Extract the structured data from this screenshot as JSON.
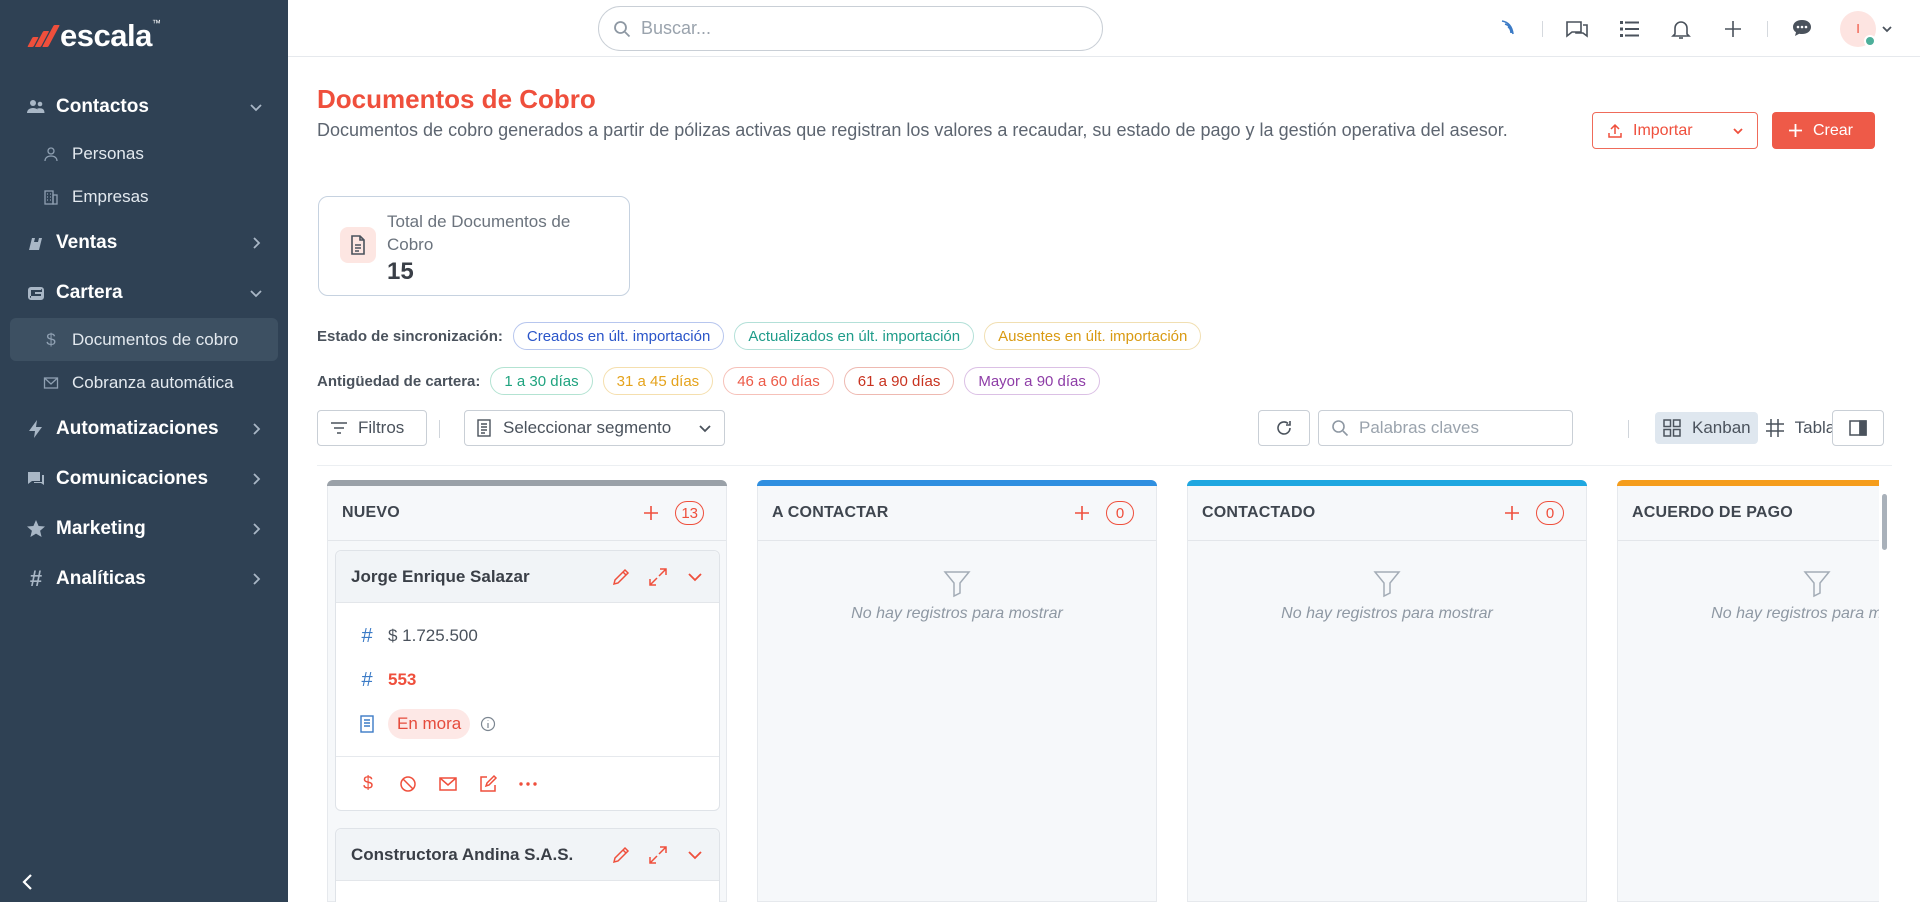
{
  "app": {
    "brand": "escala",
    "brand_tm": "™"
  },
  "sidebar": {
    "groups": [
      {
        "label": "Contactos",
        "icon": "contacts-icon",
        "expanded": true
      },
      {
        "label": "Ventas",
        "icon": "sales-icon",
        "expanded": false
      },
      {
        "label": "Cartera",
        "icon": "wallet-icon",
        "expanded": true
      },
      {
        "label": "Automatizaciones",
        "icon": "bolt-icon",
        "expanded": false
      },
      {
        "label": "Comunicaciones",
        "icon": "chat-icon",
        "expanded": false
      },
      {
        "label": "Marketing",
        "icon": "star-icon",
        "expanded": false
      },
      {
        "label": "Analíticas",
        "icon": "hash-icon",
        "expanded": false
      }
    ],
    "contactos_items": [
      {
        "label": "Personas"
      },
      {
        "label": "Empresas"
      }
    ],
    "cartera_items": [
      {
        "label": "Documentos de cobro",
        "active": true
      },
      {
        "label": "Cobranza automática"
      }
    ]
  },
  "topbar": {
    "search_placeholder": "Buscar...",
    "avatar_initial": "I"
  },
  "page": {
    "title": "Documentos de Cobro",
    "description": "Documentos de cobro generados a partir de pólizas activas que registran los valores a recaudar, su estado de pago y la gestión operativa del asesor.",
    "import_label": "Importar",
    "create_label": "Crear"
  },
  "stat": {
    "label": "Total de Documentos de Cobro",
    "value": "15"
  },
  "sync": {
    "label": "Estado de sincronización:",
    "chips": [
      {
        "label": "Creados en últ. importación",
        "color": "#2a55c9"
      },
      {
        "label": "Actualizados en últ. importación",
        "color": "#1f9c8a"
      },
      {
        "label": "Ausentes en últ. importación",
        "color": "#d99a12"
      }
    ]
  },
  "aging": {
    "label": "Antigüedad de cartera:",
    "chips": [
      {
        "label": "1 a 30 días",
        "color": "#1fa37f"
      },
      {
        "label": "31 a 45 días",
        "color": "#e5a31c"
      },
      {
        "label": "46 a 60 días",
        "color": "#ec5a47"
      },
      {
        "label": "61 a 90 días",
        "color": "#c8321f"
      },
      {
        "label": "Mayor a 90 días",
        "color": "#8e3da7"
      }
    ]
  },
  "toolbar": {
    "filters_label": "Filtros",
    "segment_label": "Seleccionar segmento",
    "keywords_placeholder": "Palabras claves",
    "kanban_label": "Kanban",
    "table_label": "Tabla"
  },
  "board": {
    "columns": [
      {
        "title": "NUEVO",
        "count": "13",
        "color": "#9aa1a8"
      },
      {
        "title": "A CONTACTAR",
        "count": "0",
        "color": "#2f8fe0"
      },
      {
        "title": "CONTACTADO",
        "count": "0",
        "color": "#1fa7e0"
      },
      {
        "title": "ACUERDO DE PAGO",
        "count": "",
        "color": "#f59d1c"
      }
    ],
    "empty_text": "No hay registros para mostrar",
    "cards": [
      {
        "name": "Jorge Enrique Salazar",
        "amount": "$ 1.725.500",
        "number": "553",
        "status": "En mora"
      },
      {
        "name": "Constructora Andina S.A.S."
      }
    ]
  }
}
